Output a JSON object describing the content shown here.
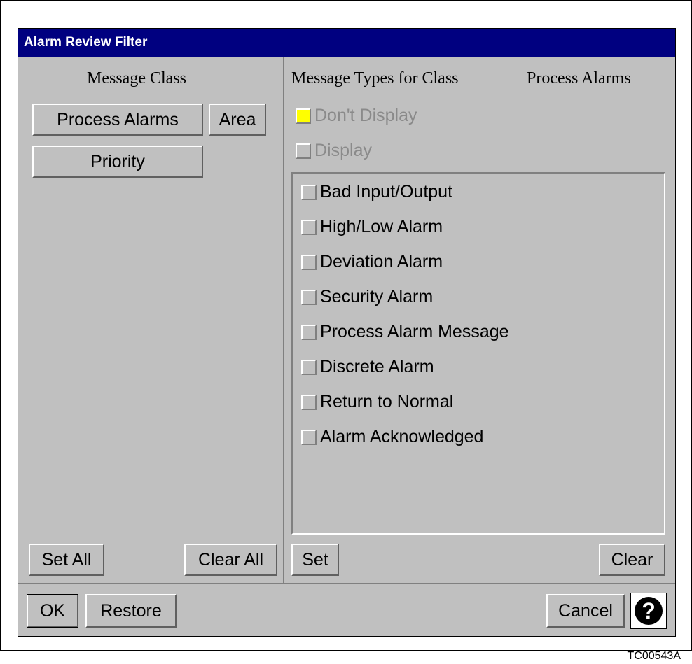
{
  "window": {
    "title": "Alarm Review Filter"
  },
  "left_panel": {
    "heading": "Message Class",
    "class_buttons": [
      "Process Alarms",
      "Area",
      "Priority"
    ],
    "set_all_label": "Set All",
    "clear_all_label": "Clear All"
  },
  "right_panel": {
    "heading": "Message Types for Class",
    "selected_class": "Process Alarms",
    "dont_display_label": "Don't Display",
    "dont_display_checked": true,
    "display_label": "Display",
    "display_checked": false,
    "message_types": [
      "Bad Input/Output",
      "High/Low Alarm",
      "Deviation Alarm",
      "Security Alarm",
      "Process Alarm Message",
      "Discrete Alarm",
      "Return to Normal",
      "Alarm Acknowledged"
    ],
    "set_label": "Set",
    "clear_label": "Clear"
  },
  "footer": {
    "ok_label": "OK",
    "restore_label": "Restore",
    "cancel_label": "Cancel",
    "help_glyph": "?",
    "help_icon": "help-icon"
  },
  "caption": "TC00543A",
  "colors": {
    "titlebar": "#000080",
    "checked": "#ffff00",
    "panel": "#c0c0c0"
  }
}
